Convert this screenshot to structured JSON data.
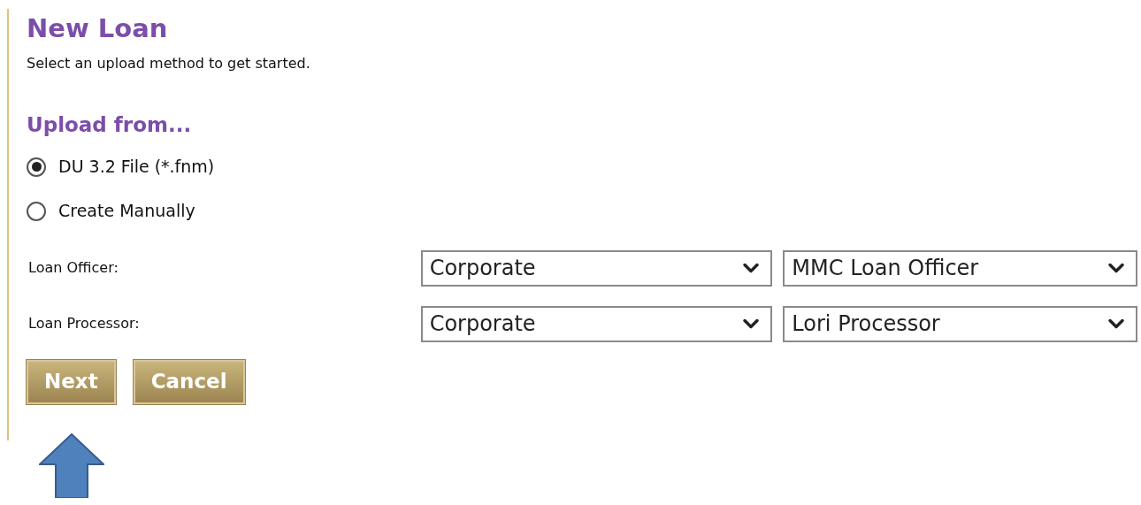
{
  "title": "New Loan",
  "subtitle": "Select an upload method to get started.",
  "upload_heading": "Upload from...",
  "upload_options": [
    {
      "label": "DU 3.2 File (*.fnm)",
      "selected": true
    },
    {
      "label": "Create Manually",
      "selected": false
    }
  ],
  "assignments": [
    {
      "label": "Loan Officer:",
      "branch": "Corporate",
      "person": "MMC Loan Officer"
    },
    {
      "label": "Loan Processor:",
      "branch": "Corporate",
      "person": "Lori Processor"
    }
  ],
  "buttons": [
    "Next",
    "Cancel"
  ]
}
